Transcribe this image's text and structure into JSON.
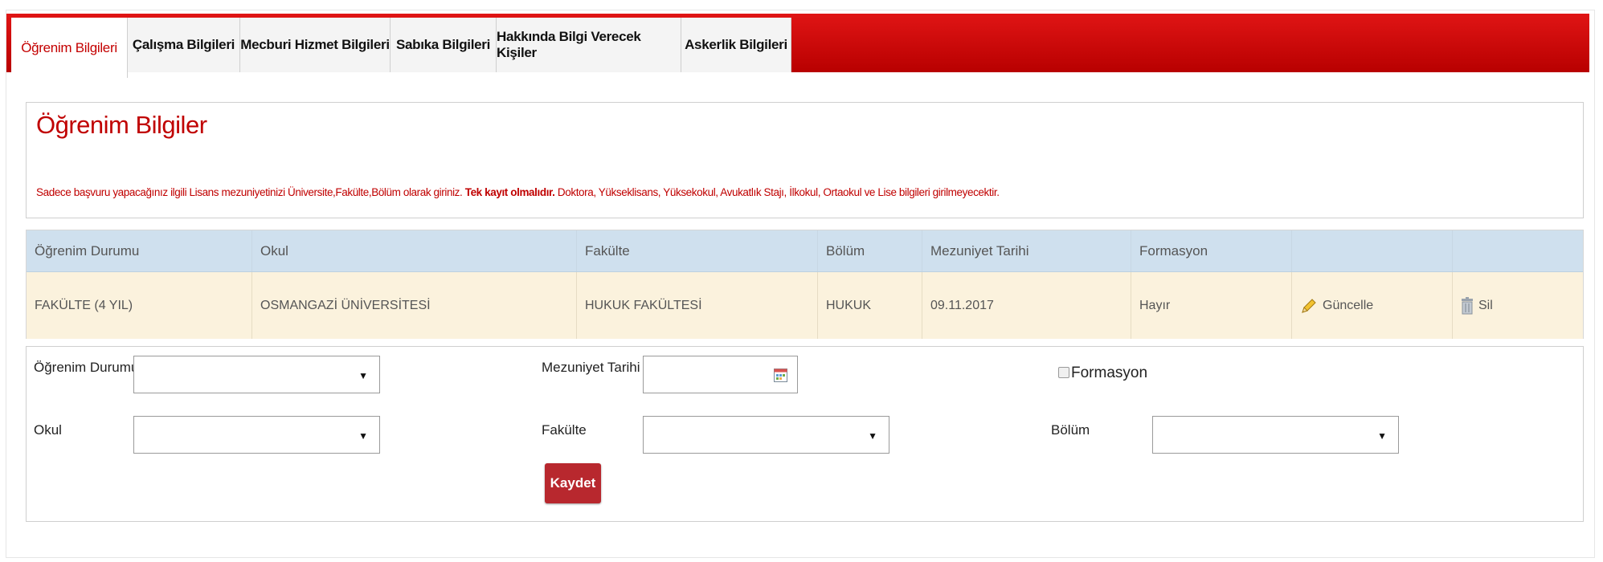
{
  "tabs": [
    {
      "label": "Öğrenim Bilgileri",
      "active": true
    },
    {
      "label": "Çalışma Bilgileri"
    },
    {
      "label": "Mecburi Hizmet Bilgileri"
    },
    {
      "label": "Sabıka Bilgileri"
    },
    {
      "label": "Hakkında Bilgi Verecek Kişiler"
    },
    {
      "label": "Askerlik Bilgileri"
    }
  ],
  "info": {
    "title": "Öğrenim Bilgiler",
    "note_part1": "Sadece başvuru yapacağınız ilgili Lisans mezuniyetinizi Üniversite,Fakülte,Bölüm olarak giriniz. ",
    "note_bold": "Tek kayıt olmalıdır.",
    "note_part2": " Doktora, Yükseklisans, Yüksekokul, Avukatlık Stajı, İlkokul, Ortaokul ve Lise bilgileri girilmeyecektir."
  },
  "table": {
    "headers": [
      "Öğrenim Durumu",
      "Okul",
      "Fakülte",
      "Bölüm",
      "Mezuniyet Tarihi",
      "Formasyon",
      "",
      ""
    ],
    "row": {
      "ogrenim_durumu": "FAKÜLTE (4 YIL)",
      "okul": "OSMANGAZİ ÜNİVERSİTESİ",
      "fakulte": "HUKUK FAKÜLTESİ",
      "bolum": "HUKUK",
      "mezuniyet_tarihi": "09.11.2017",
      "formasyon": "Hayır",
      "update_label": "Güncelle",
      "delete_label": "Sil"
    }
  },
  "form": {
    "ogrenim_durumu_label": "Öğrenim Durumu",
    "mezuniyet_tarihi_label": "Mezuniyet Tarihi",
    "formasyon_label": "Formasyon",
    "okul_label": "Okul",
    "fakulte_label": "Fakülte",
    "bolum_label": "Bölüm",
    "dropdown_arrow": "▼",
    "save_label": "Kaydet"
  },
  "colors": {
    "accent_red": "#c00000",
    "tab_bar": "#d40000",
    "table_header": "#cfe0ee",
    "table_row": "#fbf2dd",
    "save_button": "#b8282e"
  }
}
